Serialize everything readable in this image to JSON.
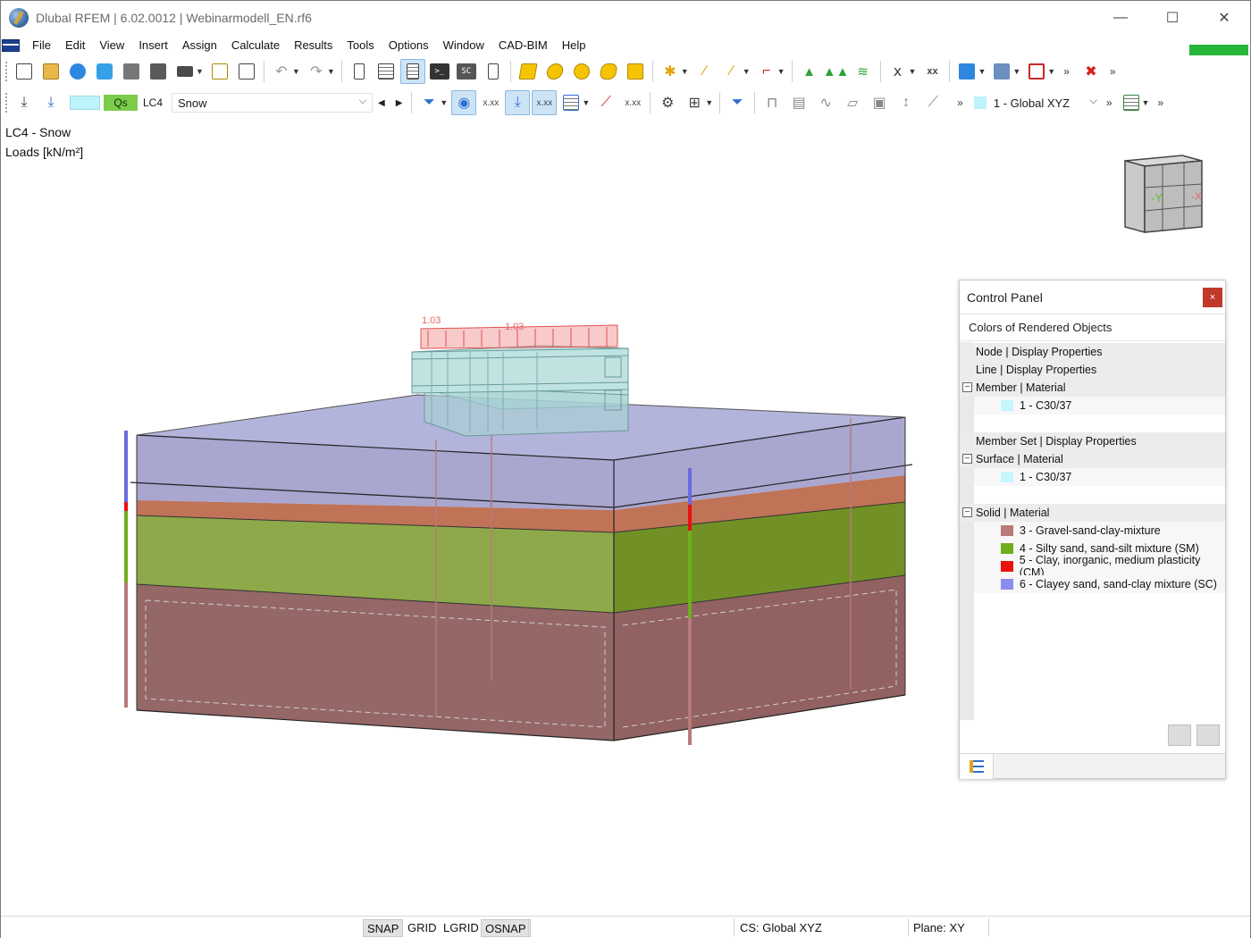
{
  "window": {
    "title": "Dlubal RFEM | 6.02.0012 | Webinarmodell_EN.rf6",
    "controls": {
      "minimize": "—",
      "maximize": "☐",
      "close": "✕"
    }
  },
  "menu": {
    "items": [
      "File",
      "Edit",
      "View",
      "Insert",
      "Assign",
      "Calculate",
      "Results",
      "Tools",
      "Options",
      "Window",
      "CAD-BIM",
      "Help"
    ]
  },
  "toolbar2": {
    "loadcase_badge": "Qs",
    "loadcase_id": "LC4",
    "loadcase_name": "Snow",
    "coordinate_system": "1 - Global XYZ",
    "more": "»"
  },
  "canvas": {
    "info_line1": "LC4 - Snow",
    "info_line2": "Loads [kN/m²]",
    "load_value_1": "1.03",
    "load_value_2": "1.03",
    "viewcube_label_y": "-Y",
    "viewcube_label_x": "-X"
  },
  "control_panel": {
    "title": "Control Panel",
    "close": "×",
    "subtitle": "Colors of Rendered Objects",
    "rows": {
      "node": "Node | Display Properties",
      "line": "Line | Display Properties",
      "member": "Member | Material",
      "member_item": "1 - C30/37",
      "member_set": "Member Set | Display Properties",
      "surface": "Surface | Material",
      "surface_item": "1 - C30/37",
      "solid": "Solid | Material",
      "solid_item_3": "3 - Gravel-sand-clay-mixture",
      "solid_item_4": "4 - Silty sand, sand-silt mixture (SM)",
      "solid_item_5": "5 - Clay, inorganic, medium plasticity (CM)",
      "solid_item_6": "6 - Clayey sand, sand-clay mixture (SC)"
    },
    "toggle_minus": "−",
    "colors": {
      "concrete": "#c6f6fb",
      "gravel": "#b87a7a",
      "silty_sand": "#6fae1d",
      "clay": "#e8120f",
      "clayey_sand": "#8a8cf0"
    }
  },
  "statusbar": {
    "snap": "SNAP",
    "grid": "GRID",
    "lgrid": "LGRID",
    "osnap": "OSNAP",
    "cs": "CS: Global XYZ",
    "plane": "Plane: XY"
  }
}
